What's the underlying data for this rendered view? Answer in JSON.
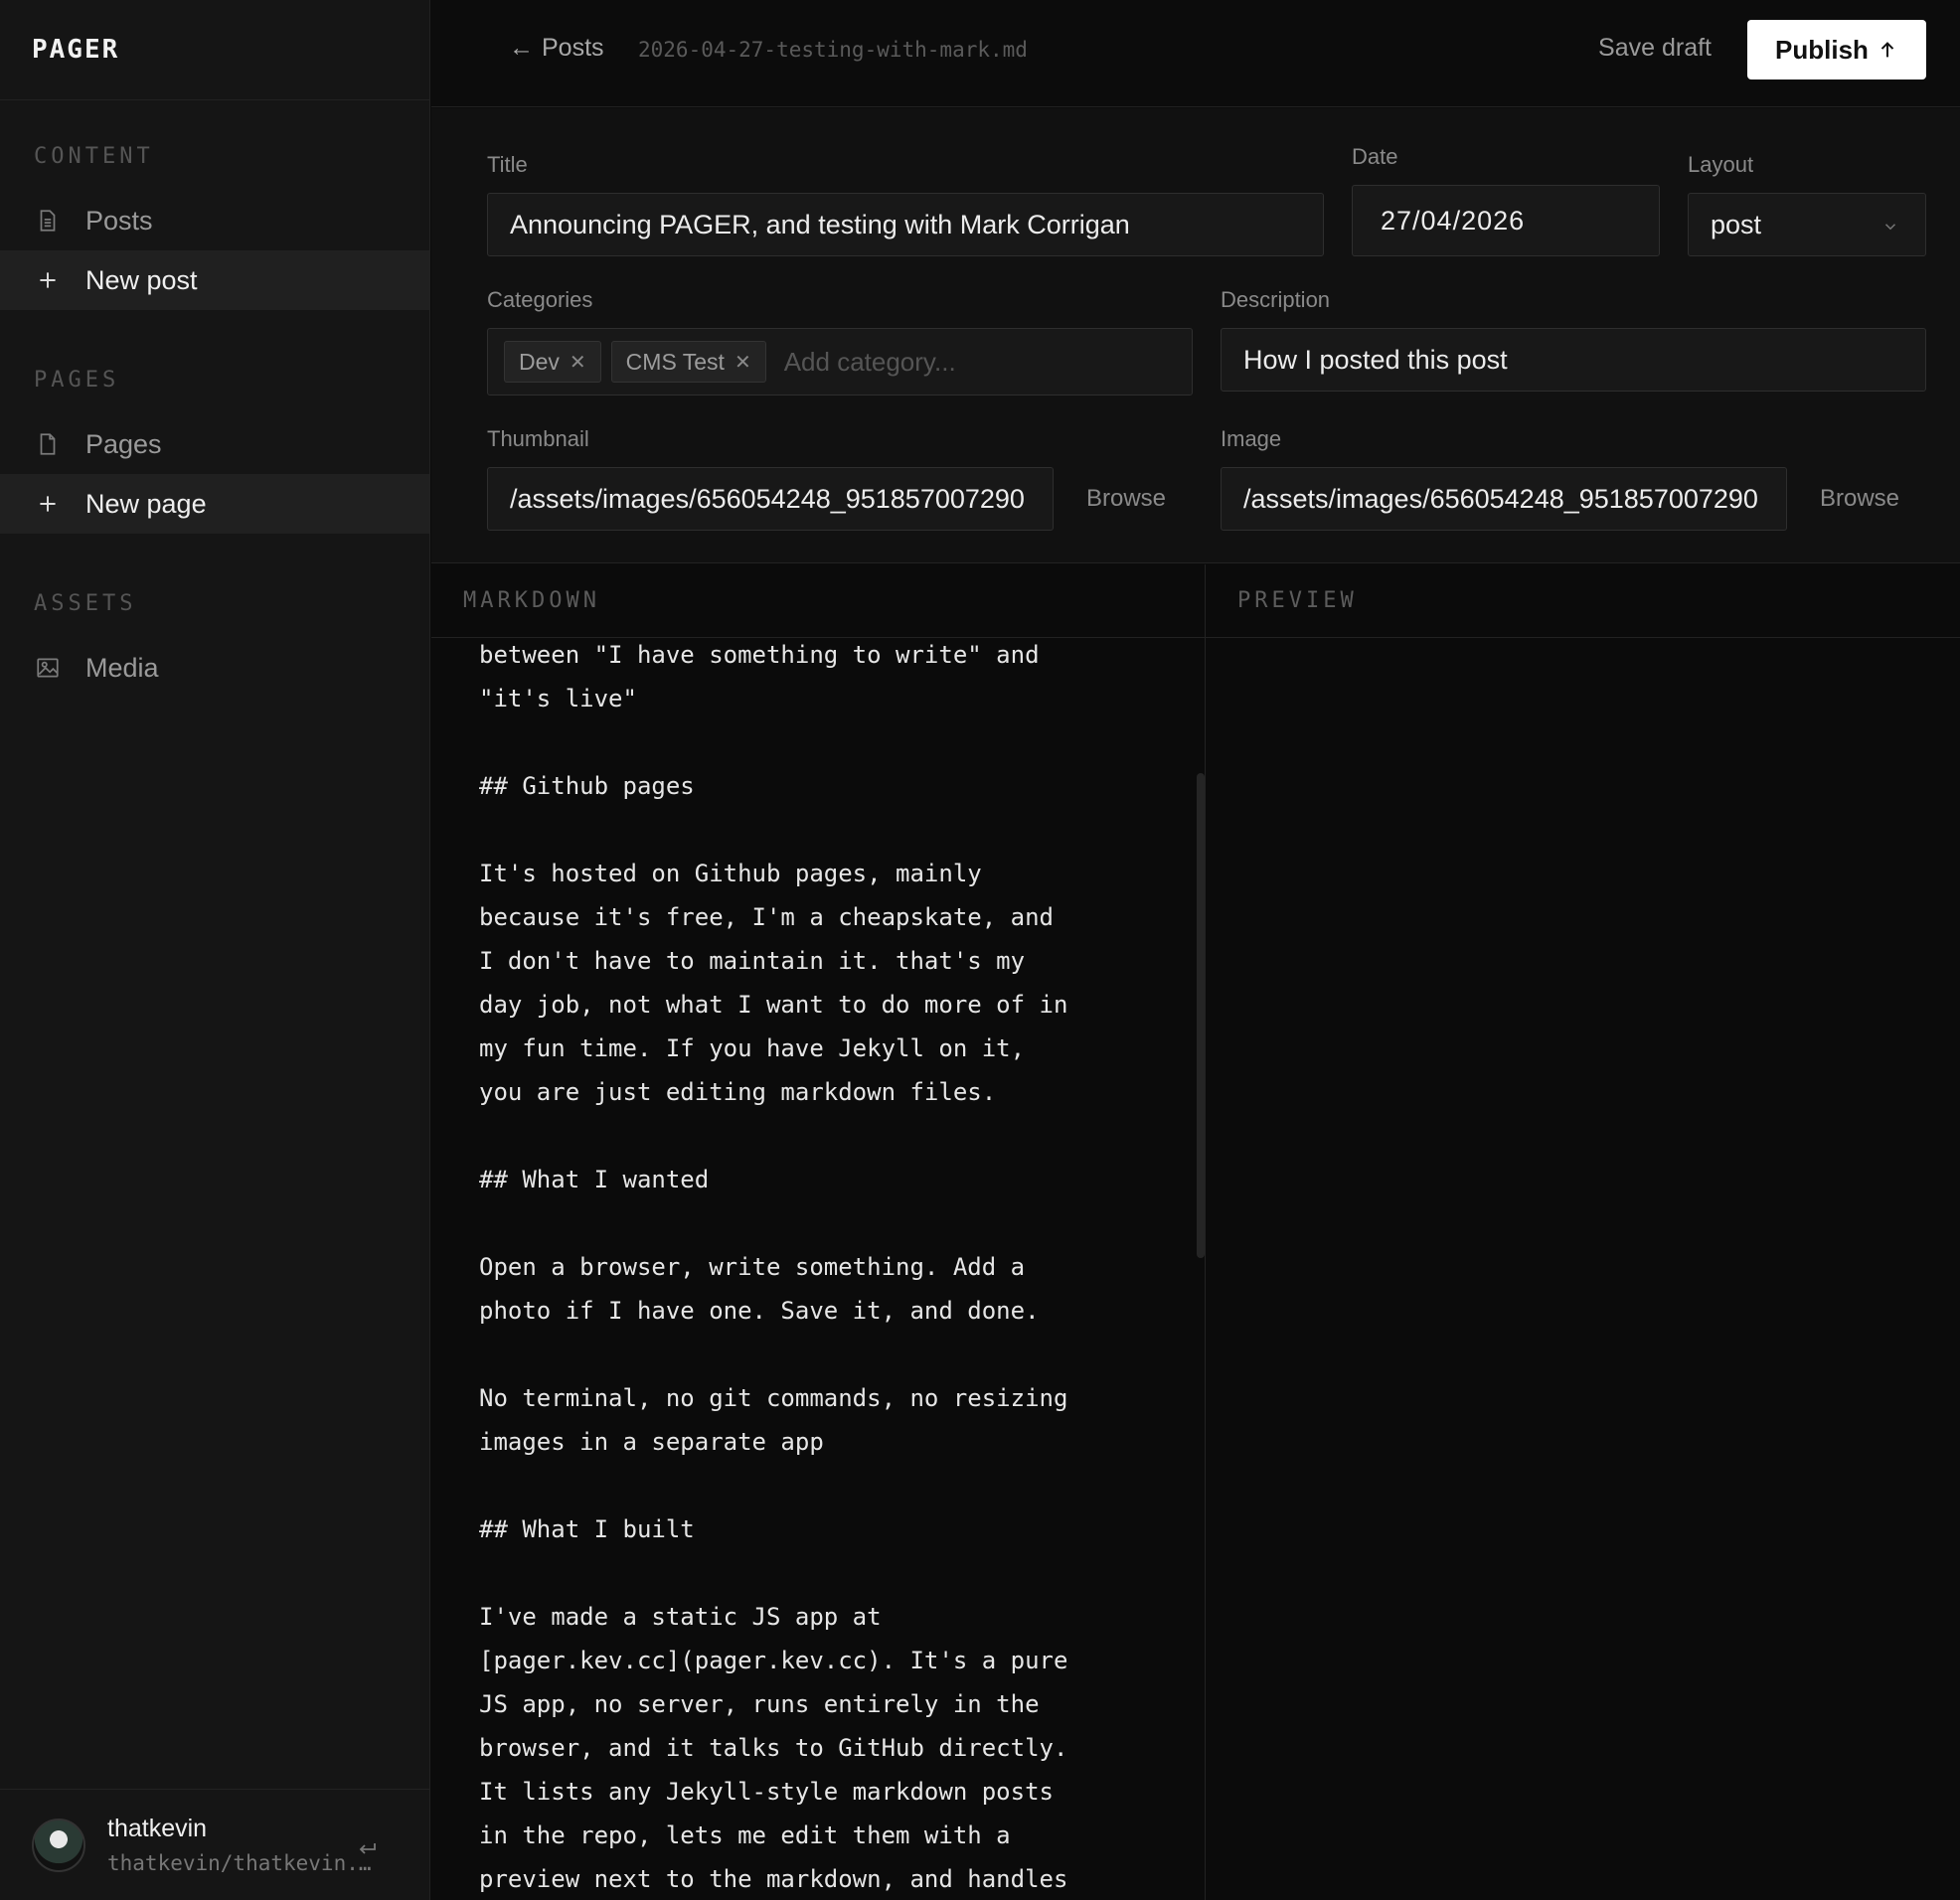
{
  "app": {
    "logo": "PAGER"
  },
  "sidebar": {
    "sections": [
      {
        "heading": "CONTENT",
        "items": [
          {
            "label": "Posts",
            "icon": "document-icon"
          },
          {
            "label": "New post",
            "icon": "plus-icon"
          }
        ]
      },
      {
        "heading": "PAGES",
        "items": [
          {
            "label": "Pages",
            "icon": "page-icon"
          },
          {
            "label": "New page",
            "icon": "plus-icon"
          }
        ]
      },
      {
        "heading": "ASSETS",
        "items": [
          {
            "label": "Media",
            "icon": "image-icon"
          }
        ]
      }
    ],
    "user": {
      "name": "thatkevin",
      "repo": "thatkevin/thatkevin.github.io"
    }
  },
  "topbar": {
    "back_label": "Posts",
    "filename": "2026-04-27-testing-with-mark.md",
    "save_draft_label": "Save draft",
    "publish_label": "Publish"
  },
  "form": {
    "title_label": "Title",
    "title_value": "Announcing PAGER, and testing with Mark Corrigan",
    "date_label": "Date",
    "date_value": "27/04/2026",
    "layout_label": "Layout",
    "layout_value": "post",
    "categories_label": "Categories",
    "categories": [
      "Dev",
      "CMS Test"
    ],
    "category_placeholder": "Add category...",
    "description_label": "Description",
    "description_value": "How I posted this post",
    "thumbnail_label": "Thumbnail",
    "thumbnail_value": "/assets/images/656054248_951857007290",
    "image_label": "Image",
    "image_value": "/assets/images/656054248_951857007290",
    "browse_label": "Browse"
  },
  "editor": {
    "markdown_heading": "MARKDOWN",
    "preview_heading": "PREVIEW",
    "markdown_text": "between \"I have something to write\" and\n\"it's live\"\n\n## Github pages\n\nIt's hosted on Github pages, mainly\nbecause it's free, I'm a cheapskate, and\nI don't have to maintain it. that's my\nday job, not what I want to do more of in\nmy fun time. If you have Jekyll on it,\nyou are just editing markdown files.\n\n## What I wanted\n\nOpen a browser, write something. Add a\nphoto if I have one. Save it, and done.\n\nNo terminal, no git commands, no resizing\nimages in a separate app\n\n## What I built\n\nI've made a static JS app at\n[pager.kev.cc](pager.kev.cc). It's a pure\nJS app, no server, runs entirely in the\nbrowser, and it talks to GitHub directly.\nIt lists any Jekyll-style markdown posts\nin the repo, lets me edit them with a\npreview next to the markdown, and handles"
  }
}
